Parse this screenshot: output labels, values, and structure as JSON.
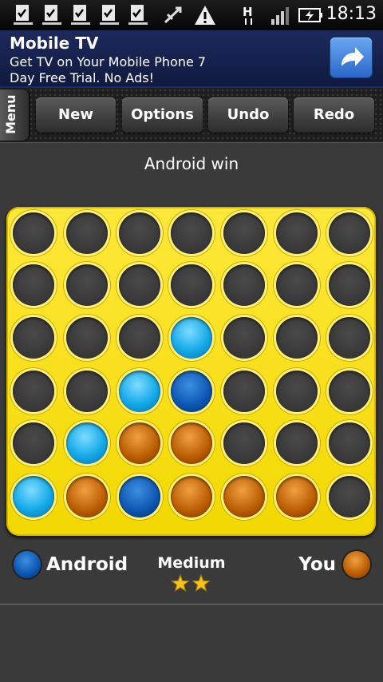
{
  "status_bar": {
    "time": "18:13",
    "network": "H",
    "icons": [
      "download-done-icon",
      "download-done-icon",
      "download-done-icon",
      "download-done-icon",
      "download-done-icon",
      "usb-debug-icon",
      "warning-icon",
      "network-h-icon",
      "signal-icon",
      "battery-charging-icon"
    ]
  },
  "ad": {
    "title": "Mobile TV",
    "description": "Get TV on Your Mobile Phone 7\nDay Free Trial. No Ads!",
    "button_icon": "share-arrow-icon"
  },
  "toolbar": {
    "menu_label": "Menu",
    "buttons": [
      "New",
      "Options",
      "Undo",
      "Redo"
    ]
  },
  "game": {
    "status": "Android win",
    "rows": 6,
    "cols": 7,
    "board": [
      [
        "empty",
        "empty",
        "empty",
        "empty",
        "empty",
        "empty",
        "empty"
      ],
      [
        "empty",
        "empty",
        "empty",
        "empty",
        "empty",
        "empty",
        "empty"
      ],
      [
        "empty",
        "empty",
        "empty",
        "android",
        "empty",
        "empty",
        "empty"
      ],
      [
        "empty",
        "empty",
        "android",
        "win",
        "empty",
        "empty",
        "empty"
      ],
      [
        "empty",
        "android",
        "you",
        "you",
        "empty",
        "empty",
        "empty"
      ],
      [
        "android",
        "you",
        "win",
        "you",
        "you",
        "you",
        "empty"
      ]
    ],
    "player_android": "Android",
    "player_you": "You",
    "level": "Medium",
    "stars": 2,
    "colors": {
      "board": "#f2d800",
      "android_chip": "#13a9e8",
      "you_chip": "#b85a00",
      "android_marker": "#0b54b0"
    }
  }
}
